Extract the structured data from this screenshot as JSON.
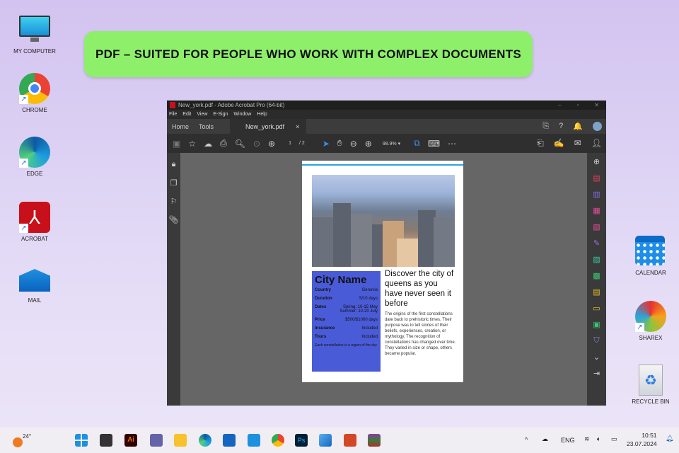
{
  "banner": {
    "text": "PDF – SUITED FOR PEOPLE WHO WORK WITH COMPLEX DOCUMENTS"
  },
  "desktop": {
    "left": [
      "MY COMPUTER",
      "CHROME",
      "EDGE",
      "ACROBAT",
      "MAIL"
    ],
    "right": [
      "CALENDAR",
      "SHAREX",
      "RECYCLE BIN"
    ]
  },
  "acrobat": {
    "title": "New_york.pdf - Adobe Acrobat Pro (64-bit)",
    "menu": [
      "File",
      "Edit",
      "View",
      "E-Sign",
      "Window",
      "Help"
    ],
    "tabs": {
      "home": "Home",
      "tools": "Tools",
      "doc": "New_york.pdf",
      "close": "×"
    },
    "page": {
      "current": "1",
      "total": "/ 2"
    },
    "zoom": "98.9%"
  },
  "pdf": {
    "card_title": "City Name",
    "rows": [
      {
        "k": "Country",
        "v": "Genovia"
      },
      {
        "k": "Duration",
        "v": "5/10 days"
      },
      {
        "k": "Dates",
        "v": "Spring: 10-15 May Summer: 10-20 July"
      },
      {
        "k": "Price",
        "v": "$500/$1000 days"
      },
      {
        "k": "Insurance",
        "v": "Included"
      },
      {
        "k": "Tours",
        "v": "Included"
      }
    ],
    "note": "Each constellation is a region of the sky",
    "heading": "Discover the city of queens as you have never seen it before",
    "body": "The origins of the first constellations date back to prehistoric times. Their purpose was to tell stories of their beliefs, experiences, creation, or mythology. The recognition of constellations has changed over time. They varied in size or shape, others became popular."
  },
  "taskbar": {
    "weather": "24°",
    "lang": "ENG",
    "time": "10:51",
    "date": "23.07.2024"
  }
}
